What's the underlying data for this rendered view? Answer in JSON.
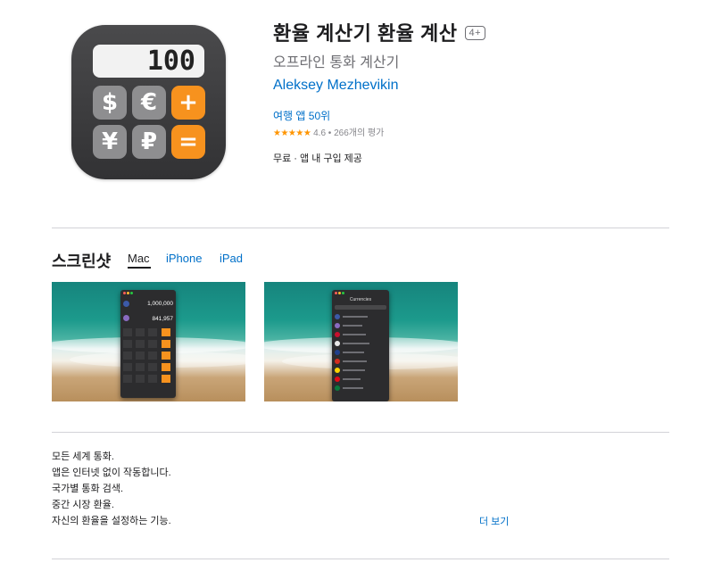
{
  "app": {
    "title": "환율 계산기 환율 계산",
    "age_rating": "4+",
    "subtitle": "오프라인 통화 계산기",
    "developer": "Aleksey Mezhevikin",
    "rank": "여행 앱 50위",
    "rating_stars": "★★★★★",
    "rating_text": "4.6 • 266개의 평가",
    "rating_value": 4.6,
    "price": "무료 · 앱 내 구입 제공",
    "accent_color": "#0070c9",
    "star_color": "#ff9500"
  },
  "icon": {
    "display_value": "100",
    "keys": [
      "$",
      "€",
      "+",
      "¥",
      "₽",
      "="
    ],
    "key_color": "#8e8e90",
    "operator_color": "#f7921e"
  },
  "screenshots": {
    "title": "스크린샷",
    "tabs": [
      "Mac",
      "iPhone",
      "iPad"
    ],
    "active_tab": "Mac",
    "shot1": {
      "amount_top": "1,000,000",
      "amount_bottom": "841,957"
    },
    "shot2": {
      "header": "Currencies"
    }
  },
  "description": {
    "lines": [
      "모든 세계 통화.",
      "앱은 인터넷 없이 작동합니다.",
      "국가별 통화 검색.",
      "중간 시장 환율.",
      "자신의 환율을 설정하는 기능."
    ],
    "more_link": "더 보기"
  }
}
